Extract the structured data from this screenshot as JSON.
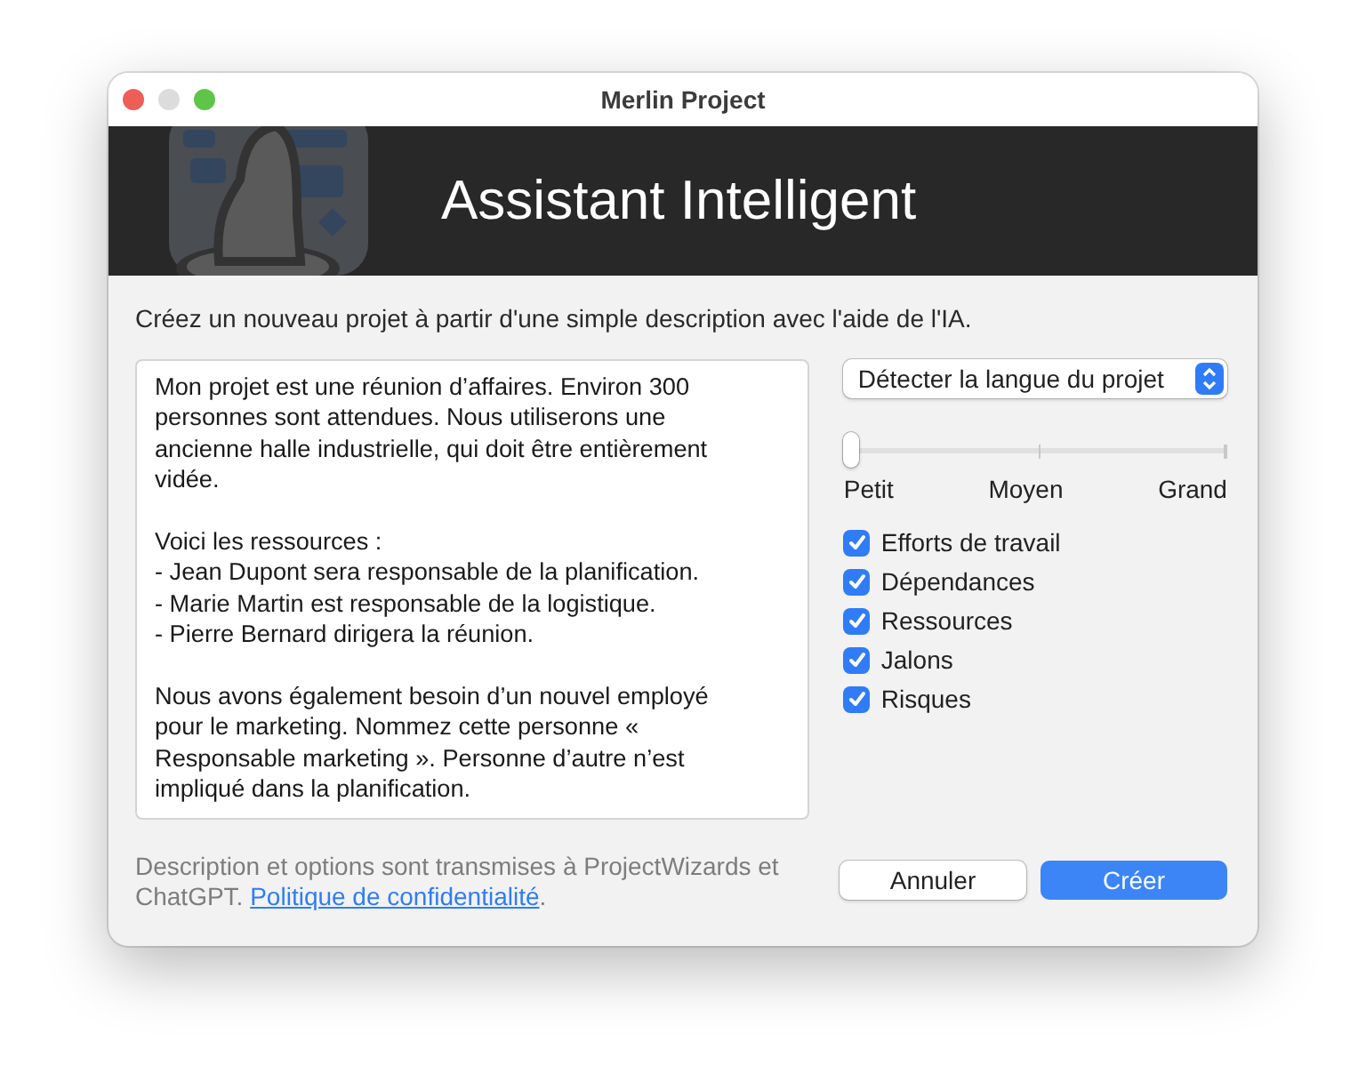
{
  "window": {
    "title": "Merlin Project"
  },
  "header": {
    "title": "Assistant Intelligent"
  },
  "intro": "Créez un nouveau projet à partir d'une simple description avec l'aide de l'IA.",
  "description": "Mon projet est une réunion d’affaires. Environ 300 personnes sont attendues. Nous utiliserons une ancienne halle industrielle, qui doit être entièrement vidée.\n\nVoici les ressources :\n- Jean Dupont sera responsable de la planification.\n- Marie Martin est responsable de la logistique.\n- Pierre Bernard dirigera la réunion.\n\nNous avons également besoin d’un nouvel employé pour le marketing. Nommez cette personne « Responsable marketing ». Personne d’autre n’est impliqué dans la planification.",
  "language_select": {
    "value": "Détecter la langue du projet"
  },
  "size_slider": {
    "level": 0,
    "labels": [
      "Petit",
      "Moyen",
      "Grand"
    ]
  },
  "options": [
    {
      "label": "Efforts de travail",
      "checked": true
    },
    {
      "label": "Dépendances",
      "checked": true
    },
    {
      "label": "Ressources",
      "checked": true
    },
    {
      "label": "Jalons",
      "checked": true
    },
    {
      "label": "Risques",
      "checked": true
    }
  ],
  "footer": {
    "text": "Description et options sont transmises à ProjectWizards et ChatGPT. ",
    "link": "Politique de confidentialité",
    "after": "."
  },
  "buttons": [
    {
      "label": "Annuler",
      "kind": "secondary"
    },
    {
      "label": "Créer",
      "kind": "primary"
    }
  ]
}
